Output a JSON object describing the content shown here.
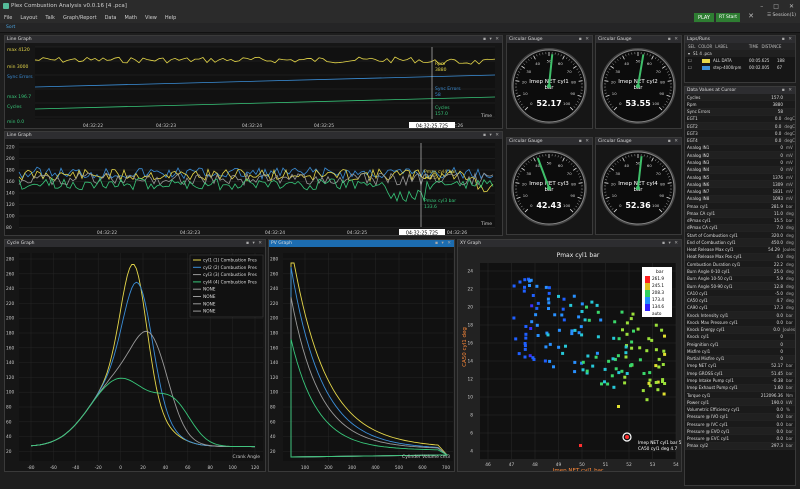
{
  "window": {
    "title": "Plex Combustion Analysis v0.0.16  [4               .pca]"
  },
  "menu": [
    "File",
    "Layout",
    "Talk",
    "Graph/Report",
    "Data",
    "Math",
    "View",
    "Help"
  ],
  "toolbar": {
    "play": "PLAY",
    "rt_start": "RT Start",
    "close": "✕",
    "sessions": "Session(1)",
    "tab": "Sort"
  },
  "line_graph_1": {
    "title": "Line Graph",
    "labels": [
      "max 4120",
      "min 3000",
      "Sync Errors",
      "max 196.7",
      "Cycles",
      "min 0.0"
    ],
    "legend": [
      "Rpm 3880",
      "Sync Errors 58",
      "Cycles 157.0"
    ],
    "time_ticks": [
      "04:32:22",
      "04:32:23",
      "04:32:24",
      "04:32:25",
      "04:32:26"
    ],
    "cursor": "04:32:25.725",
    "xlabel": "Time"
  },
  "line_graph_2": {
    "title": "Line Graph",
    "y_ticks": [
      "220",
      "200",
      "180",
      "160",
      "140",
      "120",
      "100",
      "80"
    ],
    "legend": [
      "Pmax cyl4 bar 152.5",
      "Pmax cyl3 bar 133.6"
    ],
    "time_ticks": [
      "04:32:22",
      "04:32:23",
      "04:32:24",
      "04:32:25",
      "04:32:26"
    ],
    "cursor": "04:32:25.725",
    "xlabel": "Time"
  },
  "gauges": [
    {
      "title": "Circular Gauge",
      "label": "Imep NET cyl1 bar",
      "value": "52.17",
      "needle": 52.17
    },
    {
      "title": "Circular Gauge",
      "label": "Imep NET cyl2 bar",
      "value": "53.55",
      "needle": 53.55
    },
    {
      "title": "Circular Gauge",
      "label": "Imep NET cyl3 bar",
      "value": "42.43",
      "needle": 42.43
    },
    {
      "title": "Circular Gauge",
      "label": "Imep NET cyl4 bar",
      "value": "52.36",
      "needle": 52.36
    }
  ],
  "gauge_ticks": [
    "0",
    "10",
    "20",
    "30",
    "40",
    "50",
    "60",
    "70",
    "80",
    "90",
    "100"
  ],
  "cycle_graph": {
    "title": "Cycle Graph",
    "legend": [
      "cyl1 (1) Combustion Pres",
      "cyl2 (2) Combustion Pres",
      "cyl3 (3) Combustion Pres",
      "cyl4 (4) Combustion Pres",
      "NONE",
      "NONE",
      "NONE",
      "NONE"
    ],
    "y_ticks": [
      "280",
      "260",
      "240",
      "220",
      "200",
      "180",
      "160",
      "140",
      "120",
      "100",
      "80",
      "60",
      "40",
      "20"
    ],
    "x_ticks": [
      "-80",
      "-60",
      "-40",
      "-20",
      "0",
      "20",
      "40",
      "60",
      "80",
      "100",
      "120"
    ],
    "xlabel": "Crank Angle"
  },
  "pv_graph": {
    "title": "PV Graph",
    "y_ticks": [
      "280",
      "260",
      "240",
      "220",
      "200",
      "180",
      "160",
      "140",
      "120",
      "100",
      "80",
      "60",
      "40",
      "20"
    ],
    "x_ticks": [
      "100",
      "200",
      "300",
      "400",
      "500",
      "600",
      "700"
    ],
    "xlabel": "Cylinder Volume cm3"
  },
  "xy_graph": {
    "title": "XY Graph",
    "chart_title": "Pmax cyl1 bar",
    "ylabel": "CA50 cyl1 deg",
    "xlabel": "Imep NET cyl1 bar",
    "y_ticks": [
      "24",
      "22",
      "20",
      "18",
      "16",
      "14",
      "12",
      "10",
      "8",
      "6",
      "4"
    ],
    "x_ticks": [
      "46",
      "47",
      "48",
      "49",
      "50",
      "51",
      "52",
      "53",
      "54"
    ],
    "colorbar": {
      "unit": "bar",
      "ticks": [
        "261.9",
        "245.1",
        "208.3",
        "173.4",
        "134.6"
      ],
      "mode": "auto"
    },
    "cursor_text": [
      "Imep NET cyl1 bar 52.17",
      "CA50 cyl1 deg 4.7"
    ]
  },
  "laps": {
    "title": "Laps/Runs",
    "headers": [
      "SEL",
      "COLOR",
      "LABEL",
      "TIME",
      "DISTANCE"
    ],
    "file": "S1  4                 .pca",
    "rows": [
      {
        "label": "ALL DATA",
        "time": "00:05.625",
        "distance": "188"
      },
      {
        "label": "step-4000rpm",
        "time": "00:02.005",
        "distance": "67"
      }
    ]
  },
  "data_values": {
    "title": "Data Values at Cursor",
    "rows": [
      [
        "Cycles",
        "157.0",
        ""
      ],
      [
        "Rpm",
        "3880",
        ""
      ],
      [
        "Sync Errors",
        "58",
        ""
      ],
      [
        "EGT1",
        "0.0",
        "degC"
      ],
      [
        "EGT2",
        "0.0",
        "degC"
      ],
      [
        "EGT3",
        "0.0",
        "degC"
      ],
      [
        "EGT4",
        "0.0",
        "degC"
      ],
      [
        "Analog IN1",
        "0",
        "mV"
      ],
      [
        "Analog IN2",
        "0",
        "mV"
      ],
      [
        "Analog IN3",
        "0",
        "mV"
      ],
      [
        "Analog IN4",
        "0",
        "mV"
      ],
      [
        "Analog IN5",
        "1376",
        "mV"
      ],
      [
        "Analog IN6",
        "1309",
        "mV"
      ],
      [
        "Analog IN7",
        "1831",
        "mV"
      ],
      [
        "Analog IN8",
        "1093",
        "mV"
      ],
      [
        "Pmax cyl1",
        "281.9",
        "bar"
      ],
      [
        "Pmax CA cyl1",
        "11.0",
        "deg"
      ],
      [
        "dPmax cyl1",
        "15.5",
        "bar"
      ],
      [
        "dPmax CA cyl1",
        "7.0",
        "deg"
      ],
      [
        "Start of Combustion cyl1",
        "320.0",
        "deg"
      ],
      [
        "End of Combustion cyl1",
        "450.0",
        "deg"
      ],
      [
        "Heat Release Max cyl1",
        "54.29",
        "Joules"
      ],
      [
        "Heat Release Max Pos cyl1",
        "4.0",
        "deg"
      ],
      [
        "Combustion Duration cyl1",
        "22.2",
        "deg"
      ],
      [
        "Burn Angle 0-10 cyl1",
        "25.0",
        "deg"
      ],
      [
        "Burn Angle 10-50 cyl1",
        "5.9",
        "deg"
      ],
      [
        "Burn Angle 50-90 cyl1",
        "12.8",
        "deg"
      ],
      [
        "CA10 cyl1",
        "-5.0",
        "deg"
      ],
      [
        "CA50 cyl1",
        "4.7",
        "deg"
      ],
      [
        "CA90 cyl1",
        "17.3",
        "deg"
      ],
      [
        "Knock Intensity cyl1",
        "0.0",
        "bar"
      ],
      [
        "Knock Max Pressure cyl1",
        "0.0",
        "bar"
      ],
      [
        "Knock Energy cyl1",
        "0.0",
        "Joules"
      ],
      [
        "Knock cyl1",
        "0",
        ""
      ],
      [
        "Preignition cyl1",
        "0",
        ""
      ],
      [
        "Misfire cyl1",
        "0",
        ""
      ],
      [
        "Partial Misfire cyl1",
        "0",
        ""
      ],
      [
        "Imep NET cyl1",
        "52.17",
        "bar"
      ],
      [
        "Imep GROSS cyl1",
        "51.45",
        "bar"
      ],
      [
        "Imep Intake Pump cyl1",
        "-0.38",
        "bar"
      ],
      [
        "Imep Exhaust Pump cyl1",
        "1.60",
        "bar"
      ],
      [
        "Torque cyl1",
        "212096.36",
        "Nm"
      ],
      [
        "Power cyl1",
        "190.0",
        "kW"
      ],
      [
        "Volumetric Efficiency cyl1",
        "0.0",
        "%"
      ],
      [
        "Pressure @ IVO cyl1",
        "0.0",
        "bar"
      ],
      [
        "Pressure @ IVC cyl1",
        "0.0",
        "bar"
      ],
      [
        "Pressure @ EVO cyl1",
        "0.0",
        "bar"
      ],
      [
        "Pressure @ EVC cyl1",
        "0.0",
        "bar"
      ],
      [
        "Pmax cyl2",
        "297.3",
        "bar"
      ]
    ]
  },
  "colors": {
    "yellow": "#e6d84a",
    "blue": "#3b8fd9",
    "green": "#38c77a",
    "grey": "#9a9a9a",
    "play": "#2e7d32",
    "active_tab": "#1c6cb0"
  }
}
